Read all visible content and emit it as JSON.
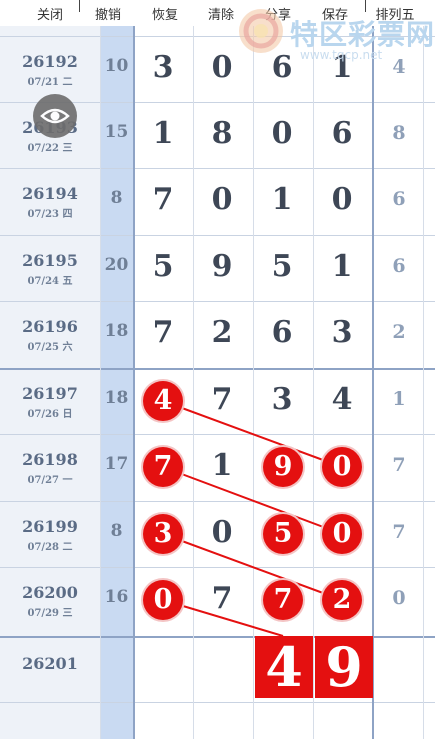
{
  "toolbar": {
    "close": "关闭",
    "undo": "撤销",
    "redo": "恢复",
    "clear": "清除",
    "share": "分享",
    "save": "保存",
    "pl5": "排列五"
  },
  "watermark": {
    "name": "特区彩票网",
    "url": "www.tqcp.net"
  },
  "rows": [
    {
      "issue": "26192",
      "date": "07/21 二",
      "sum": "10",
      "d": [
        "3",
        "0",
        "6",
        "1"
      ],
      "extra": "4"
    },
    {
      "issue": "26193",
      "date": "07/22 三",
      "sum": "15",
      "d": [
        "1",
        "8",
        "0",
        "6"
      ],
      "extra": "8"
    },
    {
      "issue": "26194",
      "date": "07/23 四",
      "sum": "8",
      "d": [
        "7",
        "0",
        "1",
        "0"
      ],
      "extra": "6"
    },
    {
      "issue": "26195",
      "date": "07/24 五",
      "sum": "20",
      "d": [
        "5",
        "9",
        "5",
        "1"
      ],
      "extra": "6"
    },
    {
      "issue": "26196",
      "date": "07/25 六",
      "sum": "18",
      "d": [
        "7",
        "2",
        "6",
        "3"
      ],
      "extra": "2"
    },
    {
      "issue": "26197",
      "date": "07/26 日",
      "sum": "18",
      "d": [
        "4",
        "7",
        "3",
        "4"
      ],
      "extra": "1"
    },
    {
      "issue": "26198",
      "date": "07/27 一",
      "sum": "17",
      "d": [
        "7",
        "1",
        "9",
        "0"
      ],
      "extra": "7"
    },
    {
      "issue": "26199",
      "date": "07/28 二",
      "sum": "8",
      "d": [
        "3",
        "0",
        "5",
        "0"
      ],
      "extra": "7"
    },
    {
      "issue": "26200",
      "date": "07/29 三",
      "sum": "16",
      "d": [
        "0",
        "7",
        "7",
        "2"
      ],
      "extra": "0"
    },
    {
      "issue": "26201",
      "date": "",
      "sum": "",
      "d": [
        "",
        "",
        "",
        ""
      ],
      "extra": ""
    }
  ],
  "prediction": [
    "4",
    "9"
  ],
  "colors": {
    "ball": "#e41010",
    "sum_column": "#c9daf2",
    "grid_major": "#8ea3c5"
  },
  "icons": {
    "floating": "eye-icon"
  }
}
